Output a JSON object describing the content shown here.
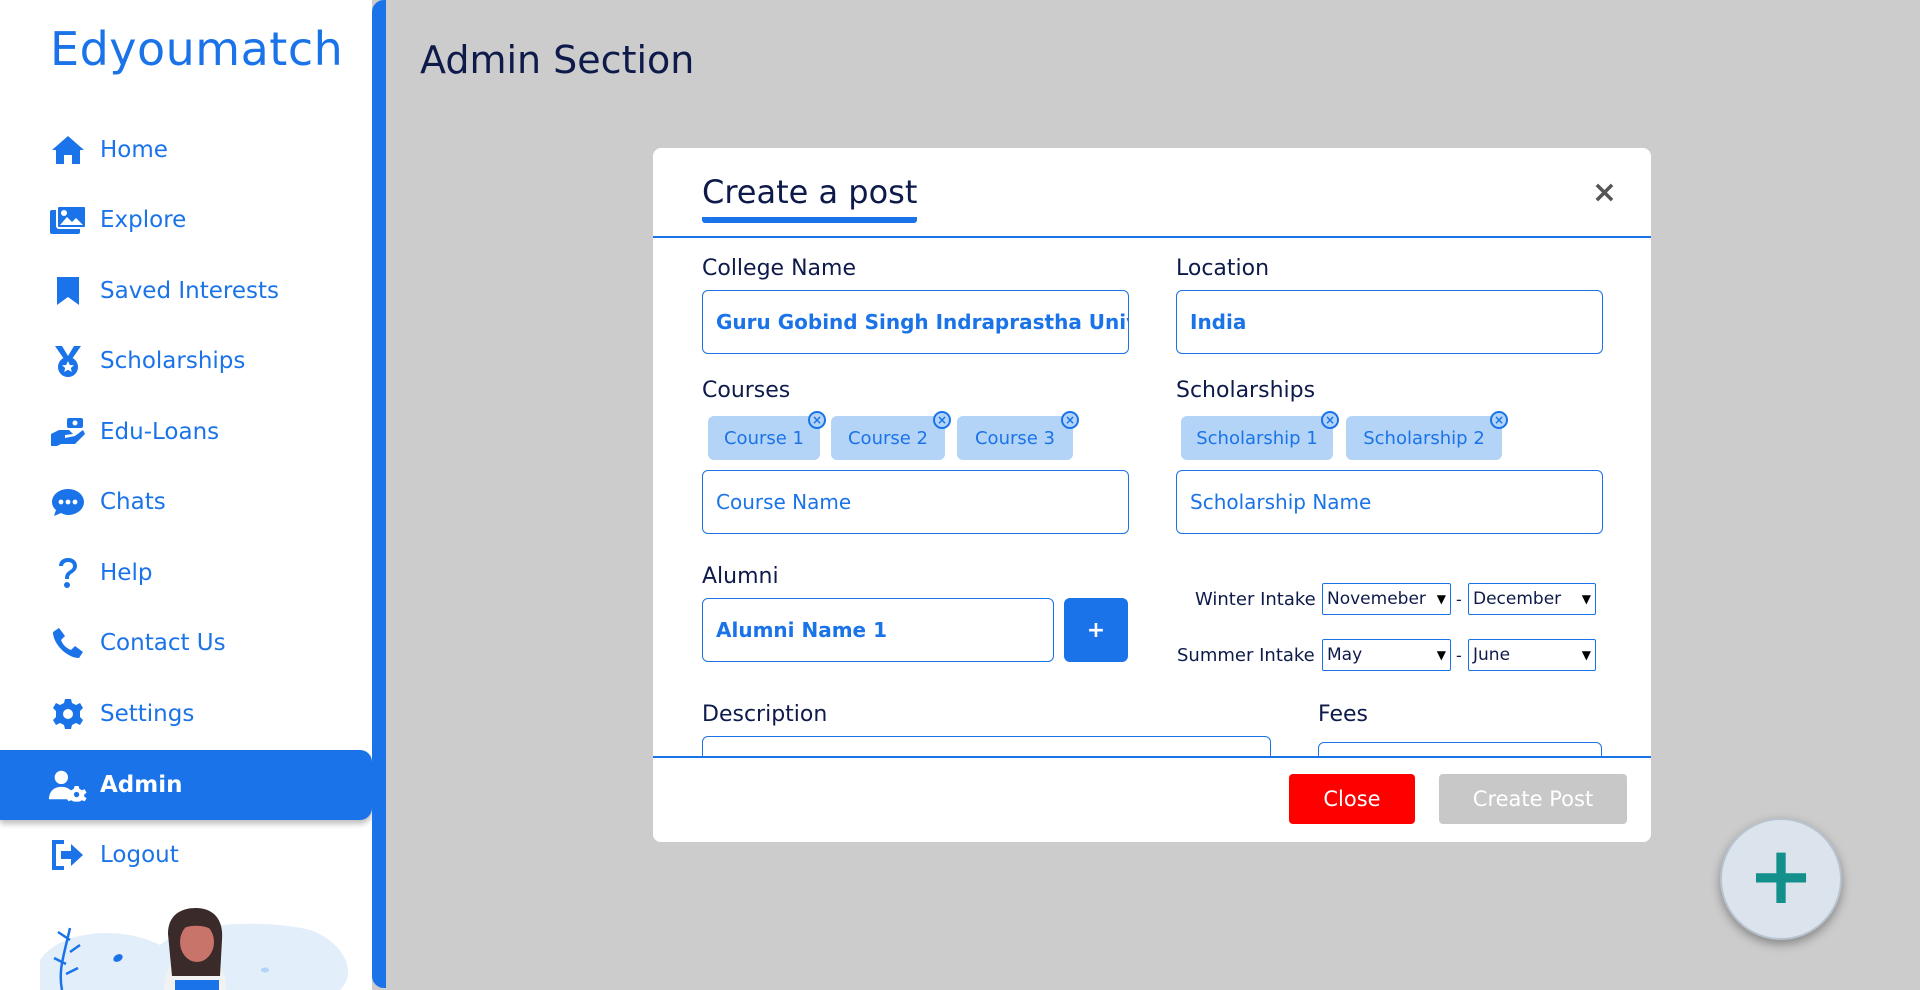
{
  "app": {
    "logo": "Edyoumatch",
    "page_title": "Admin Section"
  },
  "sidebar": {
    "items": [
      {
        "label": "Home",
        "icon": "home-icon",
        "active": false
      },
      {
        "label": "Explore",
        "icon": "explore-icon",
        "active": false
      },
      {
        "label": "Saved Interests",
        "icon": "bookmark-icon",
        "active": false
      },
      {
        "label": "Scholarships",
        "icon": "medal-icon",
        "active": false
      },
      {
        "label": "Edu-Loans",
        "icon": "loan-icon",
        "active": false
      },
      {
        "label": "Chats",
        "icon": "chat-icon",
        "active": false
      },
      {
        "label": "Help",
        "icon": "help-icon",
        "active": false
      },
      {
        "label": "Contact Us",
        "icon": "phone-icon",
        "active": false
      },
      {
        "label": "Settings",
        "icon": "gear-icon",
        "active": false
      },
      {
        "label": "Admin",
        "icon": "admin-user-icon",
        "active": true
      },
      {
        "label": "Logout",
        "icon": "logout-icon",
        "active": false
      }
    ]
  },
  "modal": {
    "title": "Create a post",
    "close_symbol": "×",
    "college": {
      "label": "College Name",
      "value": "Guru Gobind Singh Indraprastha University"
    },
    "location": {
      "label": "Location",
      "value": "India"
    },
    "courses": {
      "label": "Courses",
      "chips": [
        "Course 1",
        "Course 2",
        "Course 3"
      ],
      "placeholder": "Course Name"
    },
    "scholarships": {
      "label": "Scholarships",
      "chips": [
        "Scholarship 1",
        "Scholarship 2"
      ],
      "placeholder": "Scholarship Name"
    },
    "alumni": {
      "label": "Alumni",
      "value": "Alumni Name 1",
      "add_label": "+"
    },
    "winter_intake": {
      "label": "Winter Intake",
      "from": "Novemeber",
      "to": "December"
    },
    "summer_intake": {
      "label": "Summer Intake",
      "from": "May",
      "to": "June"
    },
    "range_separator": "-",
    "description": {
      "label": "Description"
    },
    "fees": {
      "label": "Fees"
    },
    "chip_remove_symbol": "×",
    "footer": {
      "close_label": "Close",
      "create_label": "Create Post"
    }
  },
  "fab": {
    "symbol": "+"
  },
  "colors": {
    "primary": "#1a73e8",
    "danger": "#ff0000",
    "disabled": "#c8c8c8",
    "fab_plus": "#14908c",
    "backdrop": "#cccccc"
  }
}
